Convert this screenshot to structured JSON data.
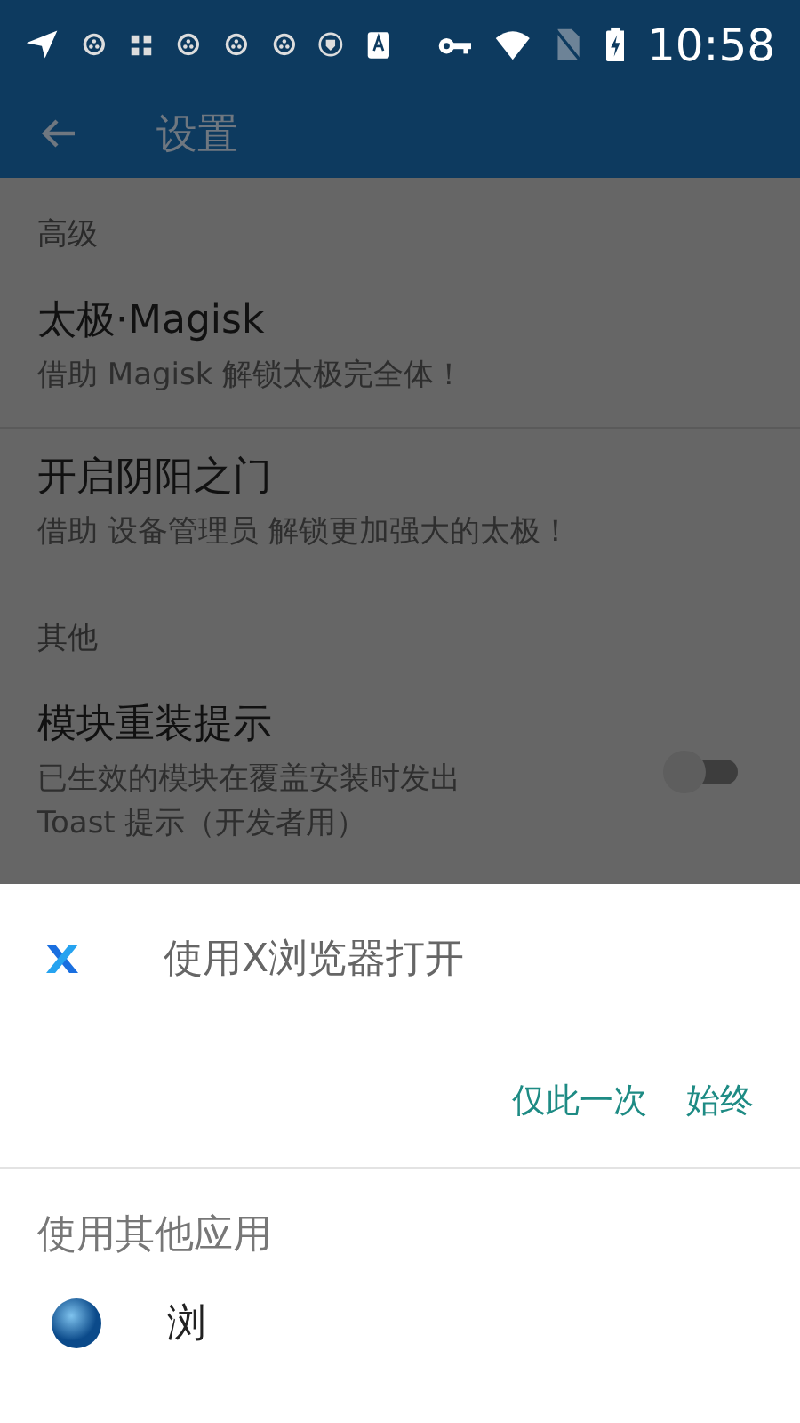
{
  "status_bar": {
    "time": "10:58"
  },
  "toolbar": {
    "title": "设置"
  },
  "sections": [
    {
      "header": "高级",
      "items": [
        {
          "kind": "text",
          "title": "太极·Magisk",
          "subtitle": "借助 Magisk 解锁太极完全体！"
        },
        {
          "kind": "text",
          "title": "开启阴阳之门",
          "subtitle": "借助 设备管理员 解锁更加强大的太极！"
        }
      ]
    },
    {
      "header": "其他",
      "items": [
        {
          "kind": "switch",
          "title": "模块重装提示",
          "subtitle": "已生效的模块在覆盖安装时发出\nToast 提示（开发者用）",
          "on": false
        }
      ]
    }
  ],
  "chooser": {
    "app_name": "使用X浏览器打开",
    "buttons": [
      "仅此一次",
      "始终"
    ],
    "other_header": "使用其他应用",
    "other_apps": [
      {
        "name": "浏"
      }
    ]
  }
}
